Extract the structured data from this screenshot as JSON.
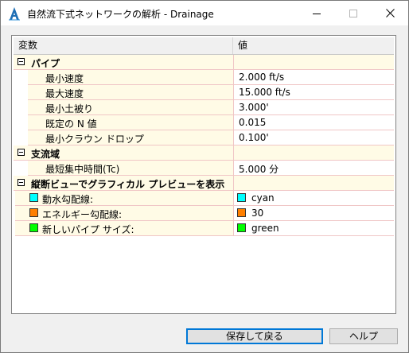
{
  "window": {
    "title": "自然流下式ネットワークの解析 - Drainage"
  },
  "grid": {
    "columns": [
      "変数",
      "値"
    ],
    "sections": [
      {
        "label": "パイプ",
        "rows": [
          {
            "name": "最小速度",
            "value": "2.000 ft/s"
          },
          {
            "name": "最大速度",
            "value": "15.000 ft/s"
          },
          {
            "name": "最小土被り",
            "value": "3.000'"
          },
          {
            "name": "既定の N 値",
            "value": "0.015"
          },
          {
            "name": "最小クラウン ドロップ",
            "value": "0.100'"
          }
        ]
      },
      {
        "label": "支流域",
        "rows": [
          {
            "name": "最短集中時間(Tc)",
            "value": "5.000 分"
          }
        ]
      },
      {
        "label": "縦断ビューでグラフィカル プレビューを表示",
        "color_rows": [
          {
            "name": "動水勾配線:",
            "value": "cyan",
            "color": "#00ffff"
          },
          {
            "name": "エネルギー勾配線:",
            "value": "30",
            "color": "#ff7f00"
          },
          {
            "name": "新しいパイプ サイズ:",
            "value": "green",
            "color": "#00ff00"
          }
        ]
      }
    ]
  },
  "buttons": {
    "save": "保存して戻る",
    "help": "ヘルプ"
  },
  "colors": {
    "row_background": "#fffbe6",
    "grid_line": "#f0c6c6",
    "default_button_border": "#0078d7"
  },
  "icons": {
    "app": "autodesk-civil-a-icon",
    "minimize": "minimize-icon",
    "maximize": "maximize-icon",
    "close": "close-icon",
    "expander": "collapse-minus-icon"
  }
}
